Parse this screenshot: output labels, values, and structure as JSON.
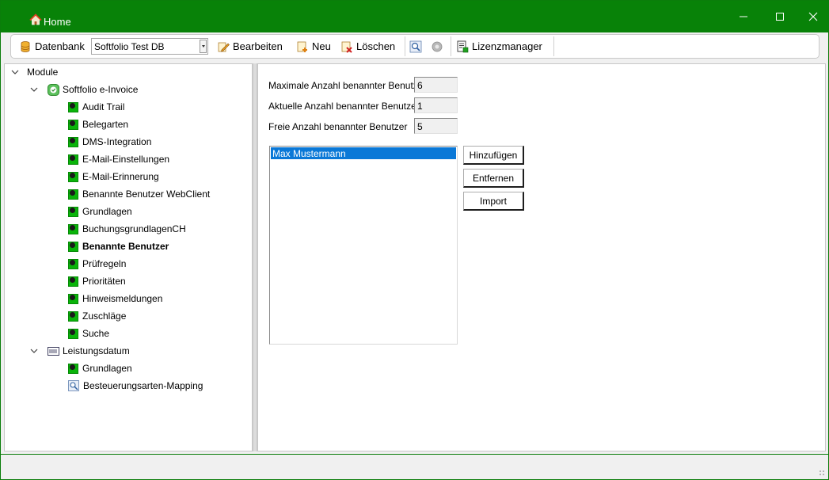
{
  "window": {
    "title": "Home",
    "accent_color": "#088208"
  },
  "toolbar": {
    "datenbank_label": "Datenbank",
    "datenbank_value": "Softfolio Test DB",
    "bearbeiten_label": "Bearbeiten",
    "neu_label": "Neu",
    "loeschen_label": "Löschen",
    "lizenzmanager_label": "Lizenzmanager"
  },
  "tree": {
    "root_label": "Module",
    "groups": [
      {
        "label": "Softfolio e-Invoice",
        "icon": "check-circle-icon",
        "items": [
          "Audit Trail",
          "Belegarten",
          "DMS-Integration",
          "E-Mail-Einstellungen",
          "E-Mail-Erinnerung",
          "Benannte Benutzer WebClient",
          "Grundlagen",
          "BuchungsgrundlagenCH",
          "Benannte Benutzer",
          "Prüfregeln",
          "Prioritäten",
          "Hinweismeldungen",
          "Zuschläge",
          "Suche"
        ],
        "selected_item": "Benannte Benutzer"
      },
      {
        "label": "Leistungsdatum",
        "icon": "calendar-icon",
        "items": [
          "Grundlagen",
          "Besteuerungsarten-Mapping"
        ]
      }
    ]
  },
  "form": {
    "max_label": "Maximale Anzahl benannter Benutzer",
    "max_value": "6",
    "current_label": "Aktuelle Anzahl benannter Benutzer",
    "current_value": "1",
    "free_label": "Freie Anzahl benannter Benutzer",
    "free_value": "5",
    "users": [
      "Max Mustermann"
    ],
    "add_button": "Hinzufügen",
    "remove_button": "Entfernen",
    "import_button": "Import"
  }
}
